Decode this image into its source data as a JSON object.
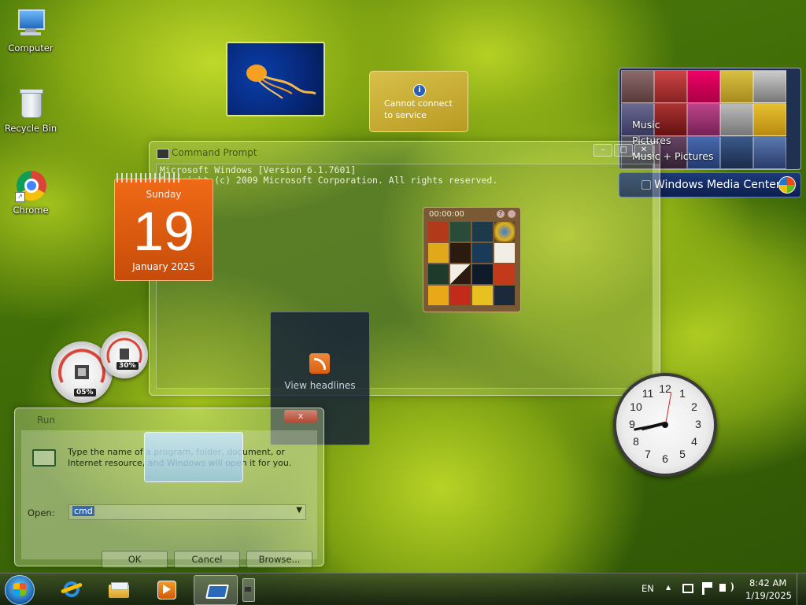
{
  "desktop_icons": [
    {
      "label": "Computer",
      "icon": "computer-icon"
    },
    {
      "label": "Recycle Bin",
      "icon": "recycle-bin-icon"
    },
    {
      "label": "Chrome",
      "icon": "chrome-icon"
    }
  ],
  "weather": {
    "message_line1": "Cannot connect",
    "message_line2": "to service",
    "info_glyph": "i"
  },
  "media_center": {
    "menu": [
      "Music",
      "Pictures",
      "Music + Pictures"
    ],
    "title": "Windows Media Center"
  },
  "cmd": {
    "title": "Command Prompt",
    "line1": "Microsoft Windows [Version 6.1.7601]",
    "line2": "Copyright (c) 2009 Microsoft Corporation.  All rights reserved.",
    "min": "–",
    "max": "□",
    "close": "✕"
  },
  "calendar": {
    "weekday": "Sunday",
    "day": "19",
    "month_year": "January 2025"
  },
  "puzzle": {
    "timer": "00:00:00"
  },
  "feed": {
    "label": "View headlines"
  },
  "meters": {
    "cpu": "05%",
    "memory": "30%"
  },
  "run": {
    "title": "Run",
    "close": "x",
    "description": "Type the name of a program, folder, document, or Internet resource, and Windows will open it for you.",
    "open_label": "Open:",
    "open_value": "cmd",
    "ok": "OK",
    "cancel": "Cancel",
    "browse": "Browse..."
  },
  "clock": {
    "numbers": [
      "12",
      "1",
      "2",
      "3",
      "4",
      "5",
      "6",
      "7",
      "8",
      "9",
      "10",
      "11"
    ]
  },
  "taskbar": {
    "items": [
      "internet-explorer-icon",
      "file-explorer-icon",
      "media-player-icon",
      "run-dialog-icon"
    ],
    "language": "EN",
    "time": "8:42 AM",
    "date": "1/19/2025",
    "tray_arrow": "▲"
  },
  "colors": {
    "accent": "#1a5ea8",
    "calendar": "#e8600f"
  }
}
